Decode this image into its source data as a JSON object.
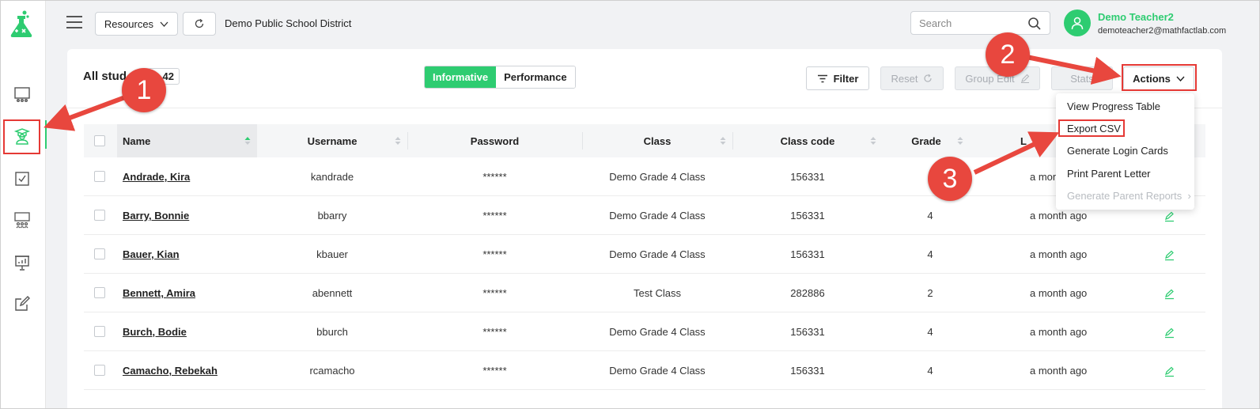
{
  "topbar": {
    "resources_label": "Resources",
    "district": "Demo Public School District",
    "search_placeholder": "Search",
    "user_name": "Demo Teacher2",
    "user_email": "demoteacher2@mathfactlab.com"
  },
  "toolbar": {
    "title": "All stud",
    "count": "42",
    "tab_informative": "Informative",
    "tab_performance": "Performance",
    "filter": "Filter",
    "reset": "Reset",
    "group_edit": "Group Edit",
    "stats": "Stats",
    "actions": "Actions"
  },
  "table": {
    "headers": {
      "name": "Name",
      "username": "Username",
      "password": "Password",
      "class": "Class",
      "class_code": "Class code",
      "grade": "Grade",
      "last": "L"
    },
    "rows": [
      {
        "name": "Andrade, Kira",
        "username": "kandrade",
        "password": "******",
        "class": "Demo Grade 4 Class",
        "code": "156331",
        "grade": "",
        "last": "a month"
      },
      {
        "name": "Barry, Bonnie",
        "username": "bbarry",
        "password": "******",
        "class": "Demo Grade 4 Class",
        "code": "156331",
        "grade": "4",
        "last": "a month ago"
      },
      {
        "name": "Bauer, Kian",
        "username": "kbauer",
        "password": "******",
        "class": "Demo Grade 4 Class",
        "code": "156331",
        "grade": "4",
        "last": "a month ago"
      },
      {
        "name": "Bennett, Amira",
        "username": "abennett",
        "password": "******",
        "class": "Test Class",
        "code": "282886",
        "grade": "2",
        "last": "a month ago"
      },
      {
        "name": "Burch, Bodie",
        "username": "bburch",
        "password": "******",
        "class": "Demo Grade 4 Class",
        "code": "156331",
        "grade": "4",
        "last": "a month ago"
      },
      {
        "name": "Camacho, Rebekah",
        "username": "rcamacho",
        "password": "******",
        "class": "Demo Grade 4 Class",
        "code": "156331",
        "grade": "4",
        "last": "a month ago"
      }
    ]
  },
  "actions_menu": {
    "items": [
      "View Progress Table",
      "Export CSV",
      "Generate Login Cards",
      "Print Parent Letter",
      "Generate Parent Reports"
    ]
  },
  "annotations": {
    "step1": "1",
    "step2": "2",
    "step3": "3"
  },
  "colors": {
    "accent": "#2ecc71",
    "annotation": "#e8473e"
  }
}
